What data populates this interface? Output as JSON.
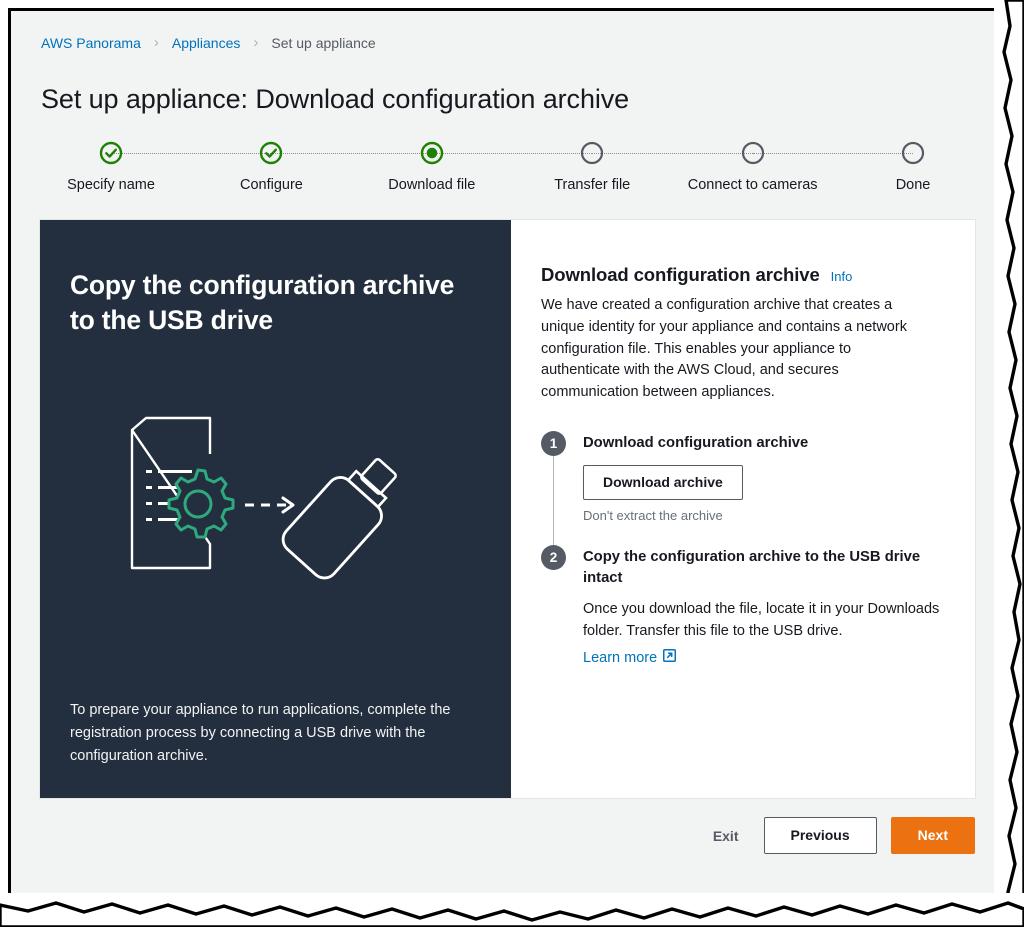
{
  "breadcrumb": {
    "items": [
      {
        "label": "AWS Panorama",
        "current": false
      },
      {
        "label": "Appliances",
        "current": false
      },
      {
        "label": "Set up appliance",
        "current": true
      }
    ],
    "separator": "›"
  },
  "page": {
    "title": "Set up appliance: Download configuration archive"
  },
  "stepper": {
    "steps": [
      {
        "label": "Specify name",
        "state": "complete"
      },
      {
        "label": "Configure",
        "state": "complete"
      },
      {
        "label": "Download file",
        "state": "current"
      },
      {
        "label": "Transfer file",
        "state": "upcoming"
      },
      {
        "label": "Connect to cameras",
        "state": "upcoming"
      },
      {
        "label": "Done",
        "state": "upcoming"
      }
    ]
  },
  "dark_panel": {
    "title": "Copy the configuration archive to the USB drive",
    "illustration_name": "config-file-to-usb-drive-illustration",
    "note": "To prepare your appliance to run applications, complete the registration process by connecting a USB drive with the configuration archive."
  },
  "content": {
    "section_title": "Download configuration archive",
    "info_label": "Info",
    "description": "We have created a configuration archive that creates a unique identity for your appliance and contains a network configuration file. This enables your appliance to authenticate with the AWS Cloud, and secures communication between appliances.",
    "steps": [
      {
        "number": "1",
        "title": "Download configuration archive",
        "button_label": "Download archive",
        "helper": "Don't extract the archive"
      },
      {
        "number": "2",
        "title": "Copy the configuration archive to the USB drive intact",
        "description": "Once you download the file, locate it in your Downloads folder. Transfer this file to the USB drive.",
        "link_label": "Learn more"
      }
    ]
  },
  "actions": {
    "exit_label": "Exit",
    "previous_label": "Previous",
    "next_label": "Next"
  },
  "colors": {
    "link": "#0073bb",
    "primary_button": "#ec7211",
    "dark_panel": "#232f3e",
    "step_complete": "#1d8102",
    "step_upcoming": "#545b64",
    "gear_accent": "#2fa97e",
    "canvas": "#f2f3f3"
  }
}
